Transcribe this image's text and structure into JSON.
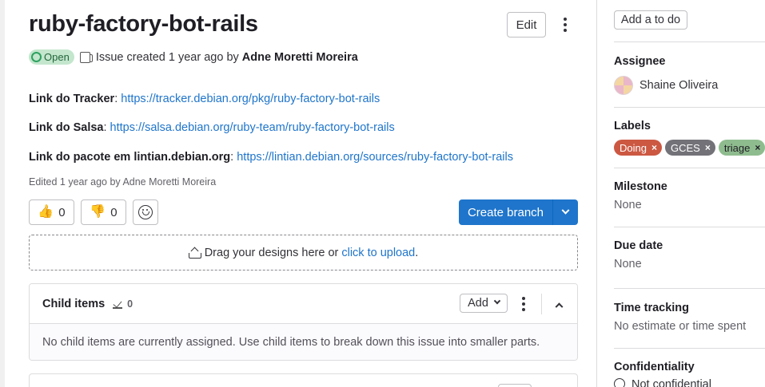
{
  "issue": {
    "title": "ruby-factory-bot-rails",
    "edit_label": "Edit",
    "status": "Open",
    "created_text": "Issue created 1 year ago by",
    "author": "Adne Moretti Moreira"
  },
  "description": {
    "lines": [
      {
        "label": "Link do Tracker",
        "sep": ": ",
        "url": "https://tracker.debian.org/pkg/ruby-factory-bot-rails"
      },
      {
        "label": "Link do Salsa",
        "sep": ": ",
        "url": "https://salsa.debian.org/ruby-team/ruby-factory-bot-rails"
      },
      {
        "label": "Link do pacote em lintian.debian.org",
        "sep": ": ",
        "url": "https://lintian.debian.org/sources/ruby-factory-bot-rails"
      }
    ],
    "edited": "Edited 1 year ago by Adne Moretti Moreira"
  },
  "reactions": {
    "thumbs_up": {
      "emoji": "👍",
      "count": "0"
    },
    "thumbs_down": {
      "emoji": "👎",
      "count": "0"
    }
  },
  "create_branch_label": "Create branch",
  "design_upload": {
    "text": "Drag your designs here or",
    "link": "click to upload",
    "suffix": "."
  },
  "child_items": {
    "title": "Child items",
    "count": "0",
    "add_label": "Add",
    "empty_text": "No child items are currently assigned. Use child items to break down this issue into smaller parts."
  },
  "sidebar": {
    "todo_label": "Add a to do",
    "assignee_heading": "Assignee",
    "assignee_name": "Shaine Oliveira",
    "labels_heading": "Labels",
    "labels": [
      {
        "name": "Doing",
        "bg": "#cc5842",
        "fg": "#ffffff"
      },
      {
        "name": "GCES",
        "bg": "#737278",
        "fg": "#ffffff"
      },
      {
        "name": "triage",
        "bg": "#8fbc8f",
        "fg": "#1f1e24"
      }
    ],
    "milestone_heading": "Milestone",
    "milestone_value": "None",
    "due_heading": "Due date",
    "due_value": "None",
    "time_heading": "Time tracking",
    "time_value": "No estimate or time spent",
    "confidentiality_heading": "Confidentiality",
    "confidentiality_value": "Not confidential"
  }
}
